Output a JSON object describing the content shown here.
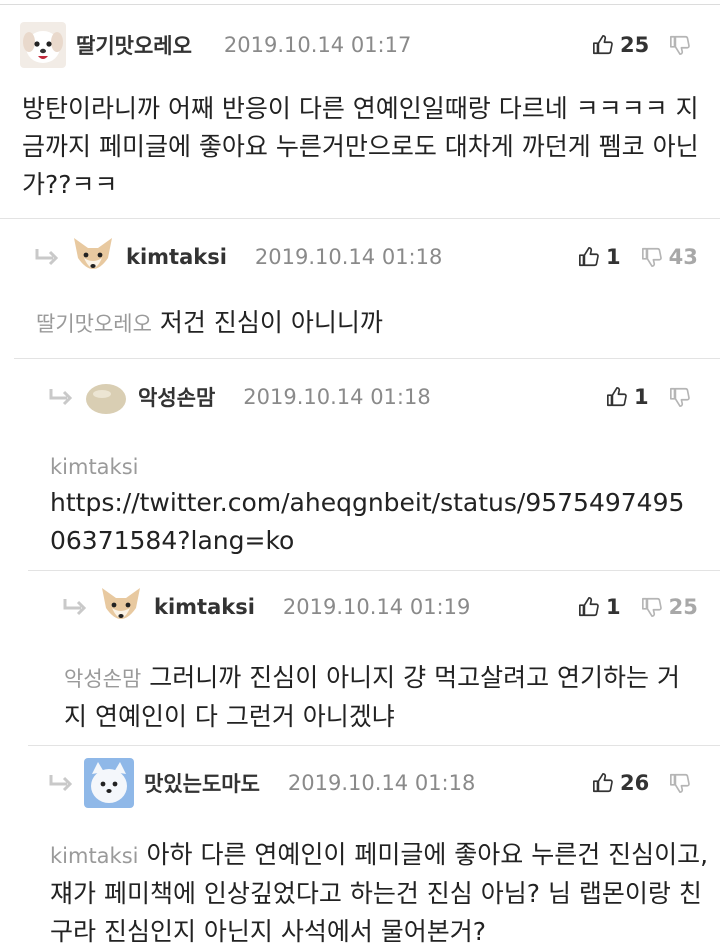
{
  "comments": [
    {
      "author": "딸기맛오레오",
      "date": "2019.10.14 01:17",
      "likes": "25",
      "dislikes": "",
      "mention": "",
      "text": "방탄이라니까 어째 반응이 다른 연예인일때랑 다르네 ㅋㅋㅋㅋ 지금까지 페미글에 좋아요 누른거만으로도 대차게 까던게 펨코 아닌가??ㅋㅋ",
      "avatar_icon": "dog-avatar-icon"
    },
    {
      "author": "kimtaksi",
      "date": "2019.10.14 01:18",
      "likes": "1",
      "dislikes": "43",
      "mention": "딸기맛오레오",
      "text": "저건 진심이 아니니까",
      "avatar_icon": "fox-avatar-icon"
    },
    {
      "author": "악성손맘",
      "date": "2019.10.14 01:18",
      "likes": "1",
      "dislikes": "",
      "mention": "kimtaksi",
      "text": "https://twitter.com/aheqgnbeit/status/957549749506371584?lang=ko",
      "avatar_icon": "blob-avatar-icon"
    },
    {
      "author": "kimtaksi",
      "date": "2019.10.14 01:19",
      "likes": "1",
      "dislikes": "25",
      "mention": "악성손맘",
      "text": "그러니까 진심이 아니지 걍 먹고살려고 연기하는 거지 연예인이 다 그런거 아니겠냐",
      "avatar_icon": "fox-avatar-icon"
    },
    {
      "author": "맛있는도마도",
      "date": "2019.10.14 01:18",
      "likes": "26",
      "dislikes": "",
      "mention": "kimtaksi",
      "text": "아하 다른 연예인이 페미글에 좋아요 누른건 진심이고, 쟤가 페미책에 인상깊었다고 하는건 진심 아님? 님 랩몬이랑 친구라 진심인지 아닌지 사석에서 물어본거?",
      "avatar_icon": "white-dog-avatar-icon"
    }
  ],
  "colors": {
    "divider": "#e3e3e3",
    "muted": "#8a8a8a",
    "text": "#222222"
  },
  "icons": {
    "like": "thumbs-up-icon",
    "dislike": "thumbs-down-icon",
    "reply": "reply-arrow-icon"
  }
}
